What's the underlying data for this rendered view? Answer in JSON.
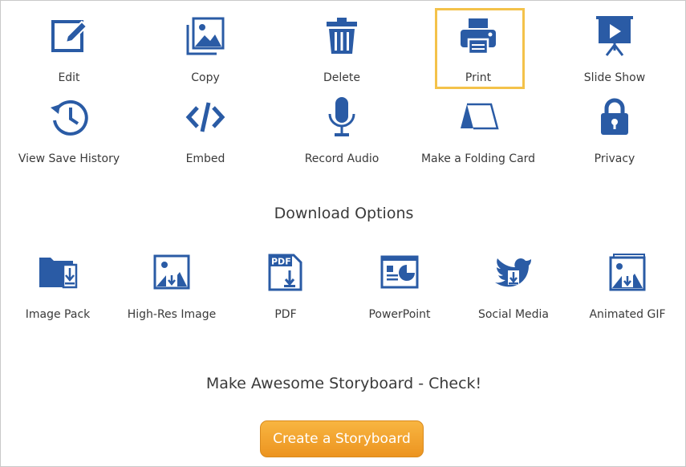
{
  "actions": [
    {
      "label": "Edit",
      "icon": "edit-icon"
    },
    {
      "label": "Copy",
      "icon": "copy-icon"
    },
    {
      "label": "Delete",
      "icon": "trash-icon"
    },
    {
      "label": "Print",
      "icon": "printer-icon",
      "selected": true
    },
    {
      "label": "Slide Show",
      "icon": "slideshow-icon"
    },
    {
      "label": "View Save History",
      "icon": "history-icon"
    },
    {
      "label": "Embed",
      "icon": "code-icon"
    },
    {
      "label": "Record Audio",
      "icon": "microphone-icon"
    },
    {
      "label": "Make a Folding Card",
      "icon": "folding-card-icon"
    },
    {
      "label": "Privacy",
      "icon": "lock-icon"
    }
  ],
  "download": {
    "title": "Download Options",
    "items": [
      {
        "label": "Image Pack",
        "icon": "folder-download-icon"
      },
      {
        "label": "High-Res Image",
        "icon": "image-download-icon"
      },
      {
        "label": "PDF",
        "icon": "pdf-download-icon"
      },
      {
        "label": "PowerPoint",
        "icon": "powerpoint-icon"
      },
      {
        "label": "Social Media",
        "icon": "twitter-download-icon"
      },
      {
        "label": "Animated GIF",
        "icon": "animated-gif-icon"
      }
    ]
  },
  "cta": {
    "heading": "Make Awesome Storyboard - Check!",
    "button_label": "Create a Storyboard"
  },
  "colors": {
    "icon": "#2a5ba5",
    "highlight": "#f4c24a",
    "button": "#f0a030"
  }
}
